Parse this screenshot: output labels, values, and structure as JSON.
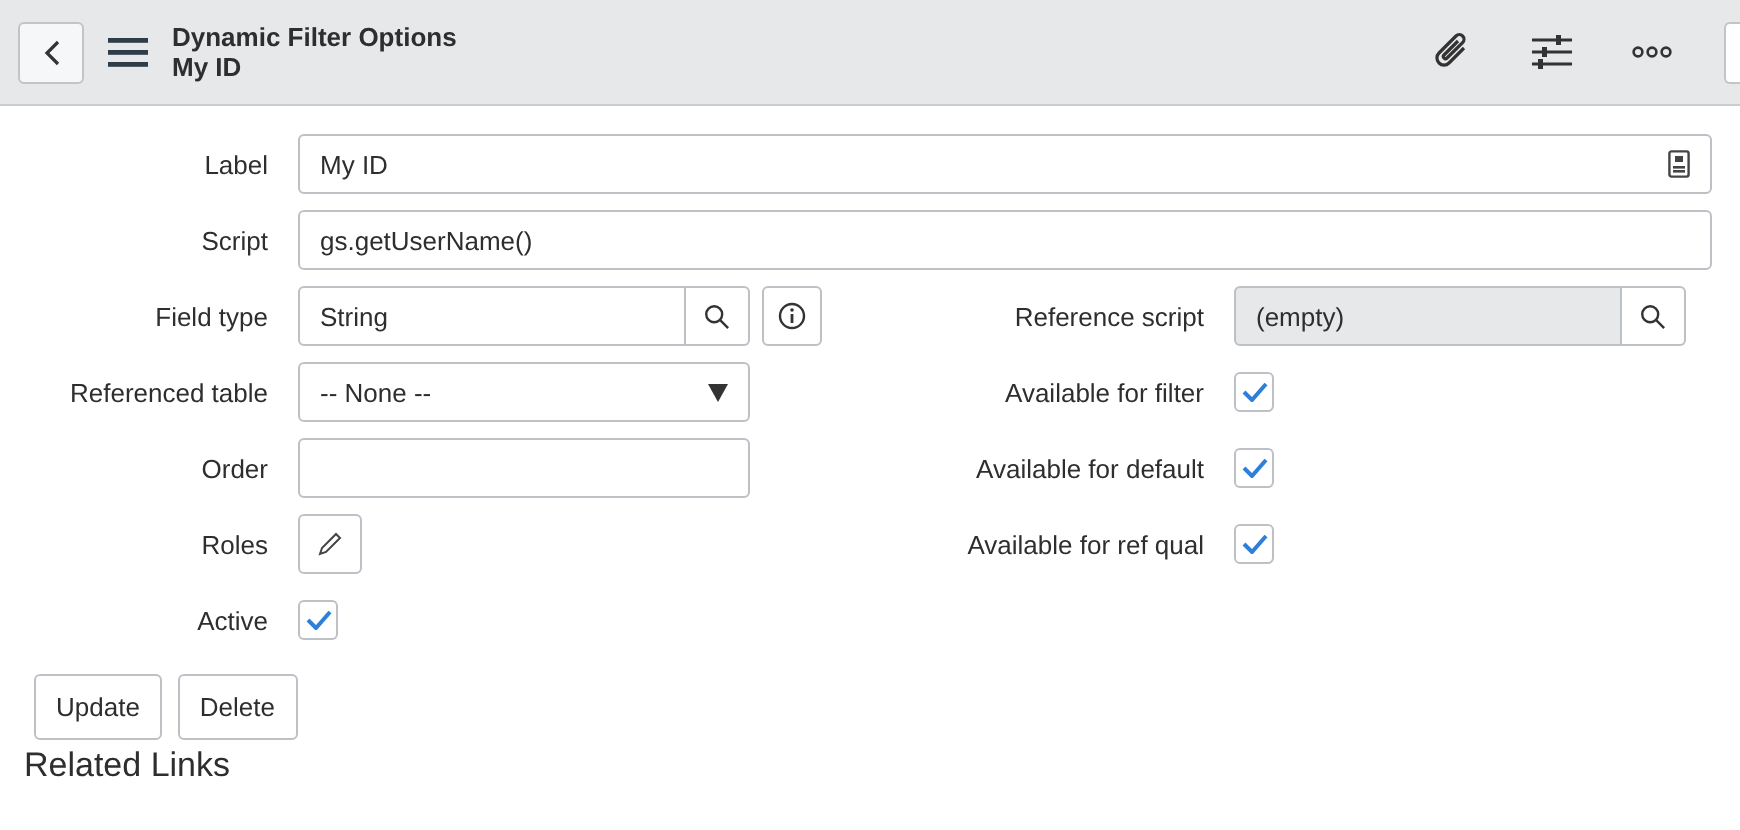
{
  "header": {
    "title": "Dynamic Filter Options",
    "subtitle": "My ID"
  },
  "rows": [
    {
      "left": {
        "kind": "text-badge",
        "label": "Label",
        "value": "My ID"
      }
    },
    {
      "left": {
        "kind": "text",
        "label": "Script",
        "value": "gs.getUserName()"
      }
    },
    {
      "left": {
        "kind": "lookup-info",
        "label": "Field type",
        "value": "String"
      },
      "right": {
        "kind": "readonly-lookup",
        "label": "Reference script",
        "value": "(empty)"
      }
    },
    {
      "left": {
        "kind": "select",
        "label": "Referenced table",
        "value": "-- None --"
      },
      "right": {
        "kind": "checkbox",
        "label": "Available for filter",
        "checked": true
      }
    },
    {
      "left": {
        "kind": "text",
        "label": "Order"
      },
      "right": {
        "kind": "checkbox",
        "label": "Available for default",
        "checked": true
      }
    },
    {
      "left": {
        "kind": "roles",
        "label": "Roles"
      },
      "right": {
        "kind": "checkbox",
        "label": "Available for ref qual",
        "checked": true
      }
    },
    {
      "left": {
        "kind": "checkbox",
        "label": "Active",
        "checked": true
      }
    }
  ],
  "buttons": [
    "Update",
    "Delete"
  ],
  "related_title": "Related Links"
}
